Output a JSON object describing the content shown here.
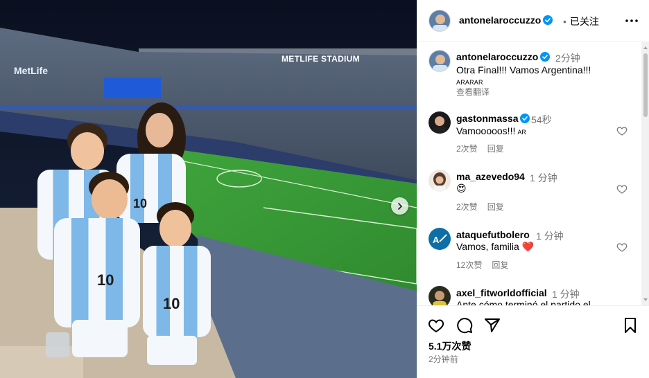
{
  "photo": {
    "stadium_sign": "METLIFE STADIUM",
    "ad_logo": "MetLife",
    "next_icon": "chevron-right-icon"
  },
  "post_header": {
    "username": "antonelaroccuzzo",
    "separator": "•",
    "follow_state": "已关注",
    "more_icon": "more-horizontal-icon"
  },
  "caption": {
    "username": "antonelaroccuzzo",
    "time": "2分钟",
    "text": "Otra Final!!! Vamos Argentina!!!",
    "flags": "ARARAR",
    "see_translation": "查看翻译"
  },
  "comments": [
    {
      "username": "gastonmassa",
      "verified": true,
      "time": "54秒",
      "text": "Vamooooos!!!",
      "tag": "AR",
      "likes": "2次赞",
      "reply": "回复"
    },
    {
      "username": "ma_azevedo94",
      "verified": false,
      "time": "1 分钟",
      "text": "😍",
      "tag": "",
      "likes": "2次赞",
      "reply": "回复"
    },
    {
      "username": "ataquefutbolero",
      "verified": false,
      "time": "1 分钟",
      "text": "Vamos, familia ❤️",
      "tag": "",
      "likes": "12次赞",
      "reply": "回复"
    },
    {
      "username": "axel_fitworldofficial",
      "verified": false,
      "time": "1 分钟",
      "text": "Ante cómo terminó el partido el",
      "tag": "",
      "likes": "",
      "reply": ""
    }
  ],
  "actions": {
    "like_icon": "heart-icon",
    "comment_icon": "comment-icon",
    "share_icon": "send-icon",
    "save_icon": "bookmark-icon"
  },
  "stats": {
    "likes": "5.1万次赞",
    "posted": "2分钟前"
  },
  "colors": {
    "verified": "#0095f6",
    "secondary_text": "#737373",
    "heart_red": "#ed1c24",
    "border": "#efefef"
  }
}
